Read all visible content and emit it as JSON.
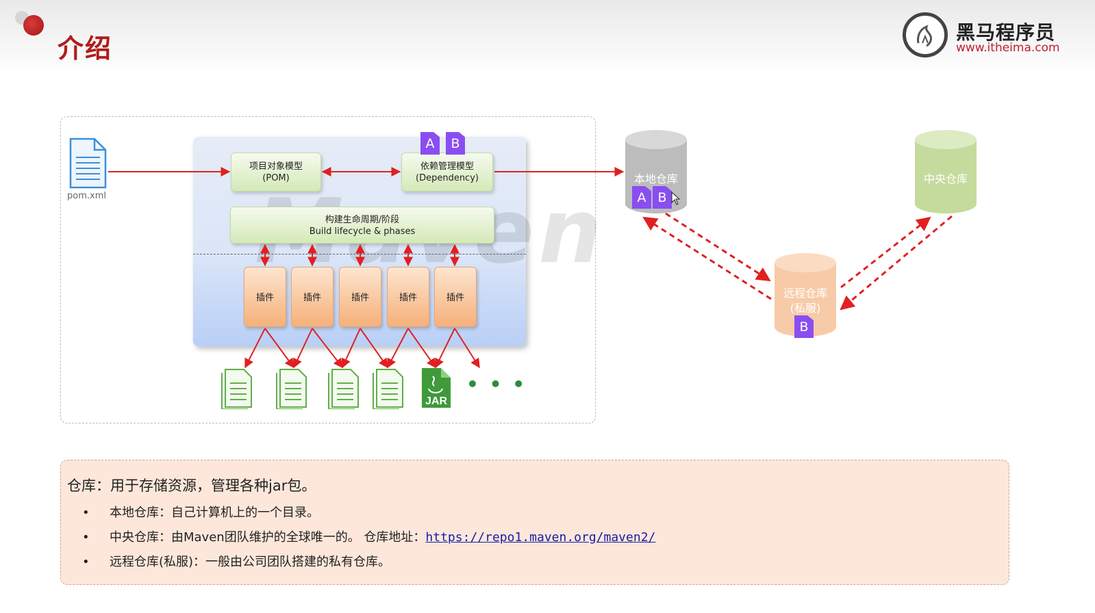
{
  "header": {
    "title": "介绍",
    "logo_cn": "黑马程序员",
    "logo_url": "www.itheima.com"
  },
  "diagram": {
    "pom_file_label": "pom.xml",
    "pom_box": {
      "line1": "项目对象模型",
      "line2": "(POM)"
    },
    "dep_box": {
      "line1": "依赖管理模型",
      "line2": "(Dependency)"
    },
    "lifecycle_box": {
      "line1": "构建生命周期/阶段",
      "line2": "Build lifecycle & phases"
    },
    "watermark": "Maven",
    "plugins": [
      "插件",
      "插件",
      "插件",
      "插件",
      "插件"
    ],
    "jar_label": "JAR",
    "ellipsis": "• • •",
    "badges": {
      "a": "A",
      "b": "B"
    },
    "repos": {
      "local": "本地仓库",
      "central": "中央仓库",
      "remote_line1": "远程仓库",
      "remote_line2": "(私服)"
    },
    "colors": {
      "arrow": "#e02020",
      "badge": "#8a4ef0",
      "local_repo": "#bdbdbd",
      "central_repo": "#c7dd9f",
      "remote_repo": "#f8cba8"
    }
  },
  "info": {
    "heading": "仓库：用于存储资源，管理各种jar包。",
    "bullet": "•",
    "item1": "本地仓库：自己计算机上的一个目录。",
    "item2_prefix": "中央仓库：由Maven团队维护的全球唯一的。 仓库地址：",
    "item2_link": "https://repo1.maven.org/maven2/",
    "item3": "远程仓库(私服)：一般由公司团队搭建的私有仓库。"
  }
}
